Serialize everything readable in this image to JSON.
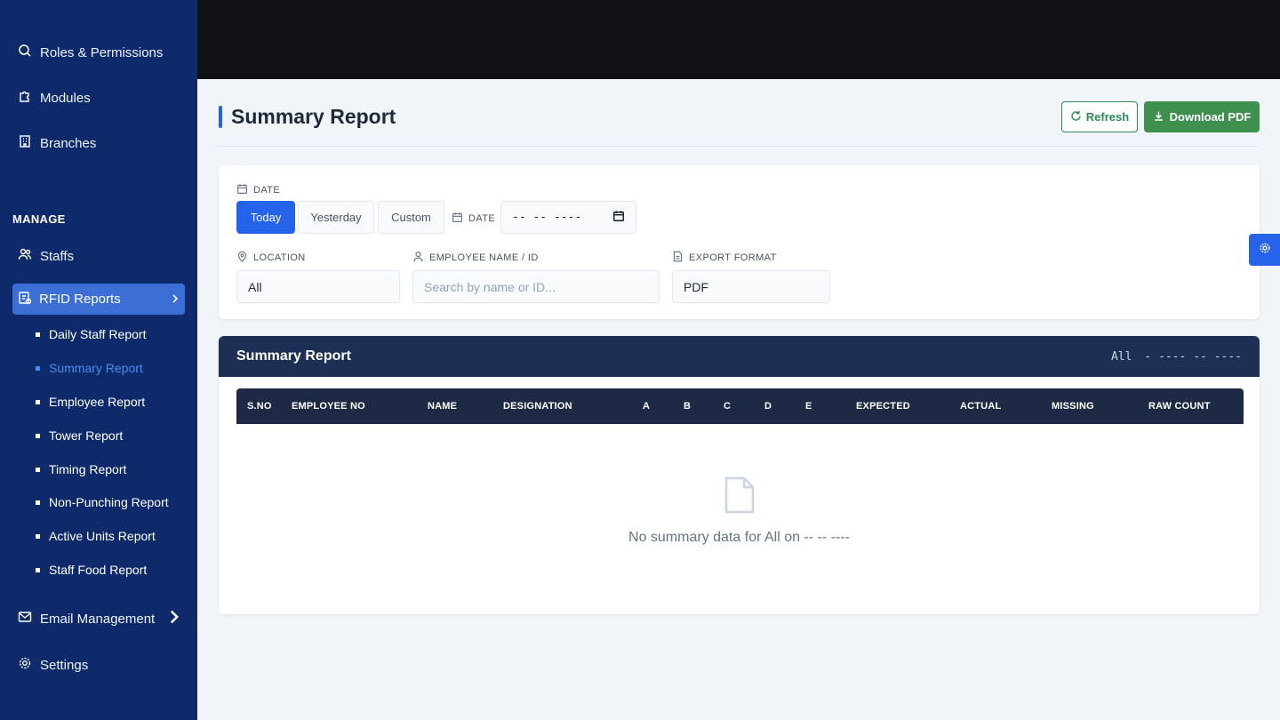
{
  "sidebar": {
    "top_items": [
      {
        "label": "Roles & Permissions",
        "icon": "key-icon"
      },
      {
        "label": "Modules",
        "icon": "puzzle-icon"
      },
      {
        "label": "Branches",
        "icon": "building-icon"
      }
    ],
    "section_label": "MANAGE",
    "staffs_label": "Staffs",
    "rfid_label": "RFID Reports",
    "sub_items": [
      {
        "label": "Daily Staff Report"
      },
      {
        "label": "Summary Report"
      },
      {
        "label": "Employee Report"
      },
      {
        "label": "Tower Report"
      },
      {
        "label": "Timing Report"
      },
      {
        "label": "Non-Punching Report"
      },
      {
        "label": "Active Units Report"
      },
      {
        "label": "Staff Food Report"
      }
    ],
    "active_sub": "Summary Report",
    "email_label": "Email Management",
    "settings_label": "Settings"
  },
  "header": {
    "title": "Summary Report",
    "refresh_label": "Refresh",
    "download_label": "Download PDF"
  },
  "filters": {
    "date_label": "DATE",
    "date_options": [
      "Today",
      "Yesterday",
      "Custom"
    ],
    "selected_date_option": "Today",
    "date_input_label": "DATE",
    "date_input_value": "-- -- ----",
    "location_label": "LOCATION",
    "location_value": "All",
    "employee_label": "EMPLOYEE NAME / ID",
    "employee_placeholder": "Search by name or ID...",
    "export_label": "EXPORT FORMAT",
    "export_value": "PDF"
  },
  "report": {
    "title": "Summary Report",
    "meta_location": "All",
    "meta_date": "- ---- -- ----",
    "columns": [
      "S.NO",
      "EMPLOYEE NO",
      "NAME",
      "DESIGNATION",
      "A",
      "B",
      "C",
      "D",
      "E",
      "EXPECTED",
      "ACTUAL",
      "MISSING",
      "RAW COUNT"
    ],
    "empty_message": "No summary data for All on -- -- ----"
  },
  "colors": {
    "sidebar_bg": "#0f2a6b",
    "accent_blue": "#2563eb",
    "success_green": "#3f8f4f",
    "table_header": "#1e2a45"
  }
}
